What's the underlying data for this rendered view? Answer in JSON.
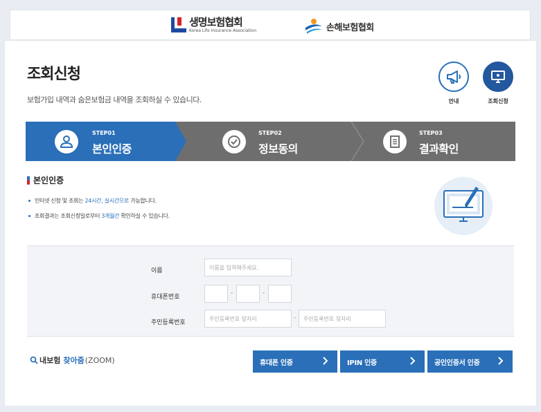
{
  "header": {
    "logo1": {
      "name": "생명보험협회",
      "sub": "Korea Life Insurance Association",
      "colors": {
        "blue": "#1f4aa1",
        "red": "#d8232a"
      }
    },
    "logo2": {
      "name": "손해보험협회"
    }
  },
  "page": {
    "title": "조회신청",
    "description": "보험가입 내역과 숨은보험금 내역을 조회하실 수 있습니다."
  },
  "quick_links": [
    {
      "label": "안내",
      "icon": "megaphone-icon"
    },
    {
      "label": "조회신청",
      "icon": "monitor-icon"
    }
  ],
  "steps": [
    {
      "num": "STEP01",
      "name": "본인인증",
      "icon": "person-icon",
      "active": true
    },
    {
      "num": "STEP02",
      "name": "정보동의",
      "icon": "check-circle-icon",
      "active": false
    },
    {
      "num": "STEP03",
      "name": "결과확인",
      "icon": "document-icon",
      "active": false
    }
  ],
  "section": {
    "title": "본인인증",
    "bullets": [
      {
        "before": "인터넷 신청 및 조회는 ",
        "highlight": "24시간, 실시간으로",
        "after": " 가능합니다."
      },
      {
        "before": "조회결과는 조회신청일로부터 ",
        "highlight": "3개월간",
        "after": " 확인하실 수 있습니다."
      }
    ]
  },
  "form": {
    "name_label": "이름",
    "name_placeholder": "이름을 입력해주세요.",
    "phone_label": "휴대폰번호",
    "phone_sep": "-",
    "rrn_label": "주민등록번호",
    "rrn_front_placeholder": "주민등록번호 앞자리",
    "rrn_sep": "-",
    "rrn_back_placeholder": "주민등록번호 뒷자리"
  },
  "zoom": {
    "part1": "내보험",
    "part2": "찾아줌",
    "part3": "(ZOOM)"
  },
  "auth_buttons": [
    {
      "label": "휴대폰 인증"
    },
    {
      "label": "IPIN 인증"
    },
    {
      "label": "공인인증서 인증"
    }
  ],
  "colors": {
    "primary": "#2a6fb8",
    "step_active": "#2a6fb8",
    "step_inactive": "#6e6e6e"
  }
}
